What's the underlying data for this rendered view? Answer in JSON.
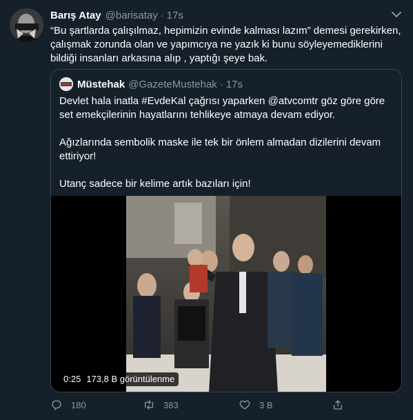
{
  "tweet": {
    "author_name": "Barış Atay",
    "author_handle": "@barisatay",
    "separator": "·",
    "time": "17s",
    "text": "“Bu şartlarda çalışılmaz, hepimizin evinde kalması lazım” demesi gerekirken, çalışmak zorunda olan ve yapımcıya ne yazık ki bunu söyleyemediklerini bildiği insanları arkasına alıp , yaptığı şeye bak."
  },
  "quoted": {
    "author_name": "Müstehak",
    "author_handle": "@GazeteMustehak",
    "separator": "·",
    "time": "17s",
    "paragraphs": [
      "Devlet hala inatla #EvdeKal çağrısı yaparken @atvcomtr göz göre göre set emekçilerinin hayatlarını tehlikeye atmaya devam ediyor.",
      "Ağızlarında sembolik maske ile tek bir önlem almadan dizilerini devam ettiriyor!",
      "Utanç sadece bir kelime artık bazıları için!"
    ],
    "video": {
      "duration": "0:25",
      "views": "173,8 B görüntülenme"
    }
  },
  "actions": {
    "replies": "180",
    "retweets": "383",
    "likes": "3 B"
  },
  "icons": [
    "caret-down-icon",
    "reply-icon",
    "retweet-icon",
    "like-icon",
    "share-icon"
  ],
  "colors": {
    "background": "#15202b",
    "muted": "#8899a6",
    "border": "#38444d"
  }
}
